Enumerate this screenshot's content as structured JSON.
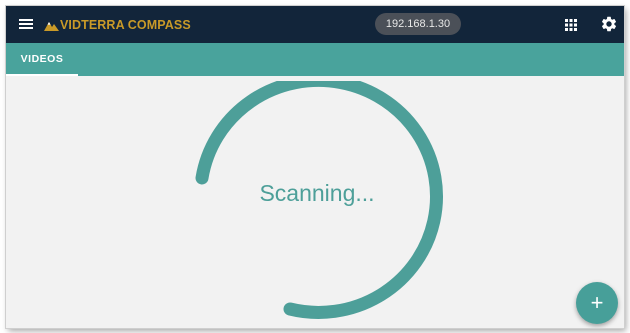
{
  "colors": {
    "appbar": "#12253a",
    "accent": "#49a39c",
    "logo_gold": "#c99a28",
    "chip": "#4b5058",
    "spinner": "#4d9f99",
    "content_bg": "#f2f2f2"
  },
  "header": {
    "menu_icon": "hamburger-menu-icon",
    "logo_text": "VIDTERRA COMPASS",
    "ip_address": "192.168.1.30",
    "apps_icon": "apps-grid-icon",
    "settings_icon": "gear-icon"
  },
  "tabs": [
    {
      "label": "VIDEOS",
      "selected": true
    }
  ],
  "main": {
    "status_text": "Scanning...",
    "spinner_icon": "progress-ring-icon"
  },
  "fab": {
    "label": "+",
    "icon": "add-icon"
  }
}
